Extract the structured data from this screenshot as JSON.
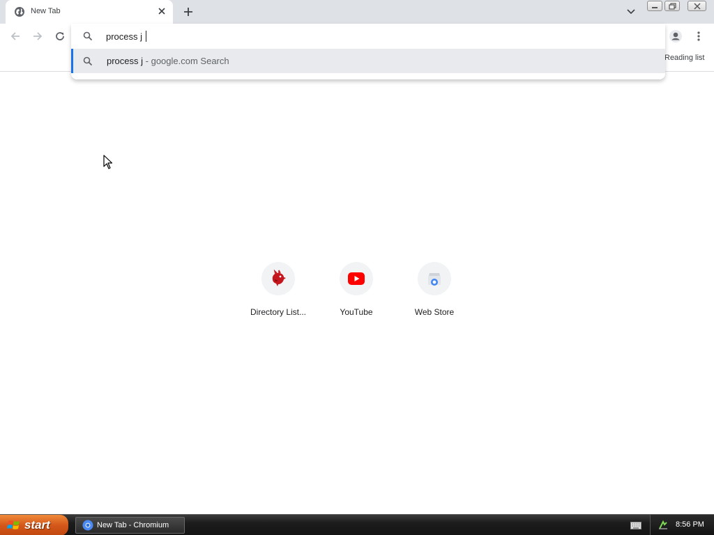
{
  "tab": {
    "title": "New Tab",
    "favicon": "globe-icon"
  },
  "omnibox": {
    "input_value": "process j",
    "suggestion": {
      "query": "process j",
      "separator": " - ",
      "source": "google.com Search"
    }
  },
  "toolbar": {
    "reading_list_label": "Reading list"
  },
  "shortcuts": [
    {
      "label": "Directory List...",
      "icon": "dragon-icon"
    },
    {
      "label": "YouTube",
      "icon": "youtube-icon"
    },
    {
      "label": "Web Store",
      "icon": "web-store-icon"
    }
  ],
  "taskbar": {
    "start_label": "start",
    "task_label": "New Tab - Chromium",
    "clock": "8:56 PM"
  },
  "colors": {
    "accent": "#1a73e8",
    "tabstrip": "#dee1e6",
    "youtube_red": "#ff0000",
    "start_orange": "#d4581a"
  }
}
